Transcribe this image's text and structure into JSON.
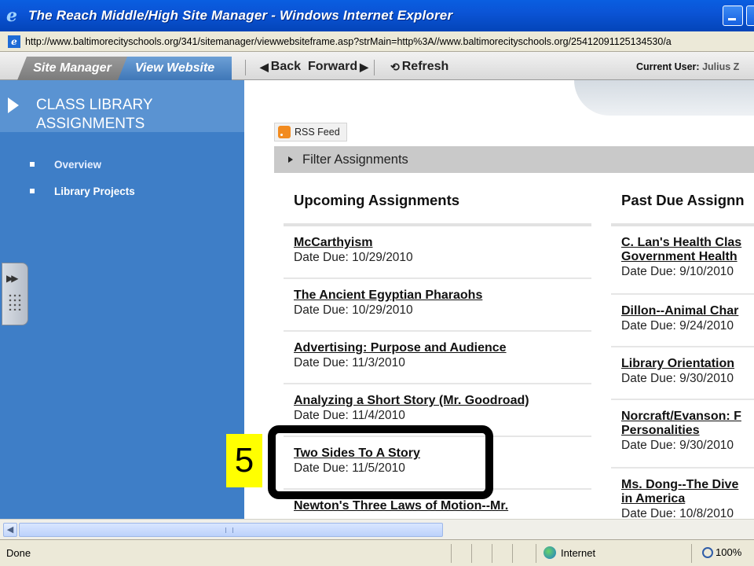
{
  "window": {
    "title": "The Reach Middle/High Site Manager - Windows Internet Explorer",
    "url": "http://www.baltimorecityschools.org/341/sitemanager/viewwebsiteframe.asp?strMain=http%3A//www.baltimorecityschools.org/25412091125134530/a"
  },
  "toolbar": {
    "tab_site_manager": "Site Manager",
    "tab_view_website": "View Website",
    "back": "Back",
    "forward": "Forward",
    "refresh": "Refresh",
    "current_user_label": "Current User:",
    "current_user_name": "Julius Z"
  },
  "sidebar": {
    "title": "CLASS LIBRARY ASSIGNMENTS",
    "items": [
      {
        "label": "Overview"
      },
      {
        "label": "Library Projects"
      }
    ]
  },
  "main": {
    "rss_label": "RSS Feed",
    "filter_label": "Filter Assignments",
    "upcoming_heading": "Upcoming Assignments",
    "past_heading": "Past Due Assignn",
    "upcoming": [
      {
        "name": "McCarthyism",
        "due": "Date Due: 10/29/2010"
      },
      {
        "name": "The Ancient Egyptian Pharaohs",
        "due": "Date Due: 10/29/2010"
      },
      {
        "name": "Advertising: Purpose and Audience",
        "due": "Date Due: 11/3/2010"
      },
      {
        "name": "Analyzing a Short Story (Mr. Goodroad)",
        "due": "Date Due: 11/4/2010"
      },
      {
        "name": "Two Sides To A Story",
        "due": "Date Due: 11/5/2010"
      },
      {
        "name": "Newton's Three Laws of Motion--Mr.",
        "due": ""
      }
    ],
    "past": [
      {
        "name": "C. Lan's Health Clas",
        "name2": "Government Health",
        "due": "Date Due: 9/10/2010"
      },
      {
        "name": "Dillon--Animal Char",
        "name2": "",
        "due": "Date Due: 9/24/2010"
      },
      {
        "name": "Library Orientation",
        "name2": "",
        "due": "Date Due: 9/30/2010"
      },
      {
        "name": "Norcraft/Evanson: F",
        "name2": "Personalities",
        "due": "Date Due: 9/30/2010"
      },
      {
        "name": "Ms. Dong--The Dive",
        "name2": "in America",
        "due": "Date Due: 10/8/2010"
      }
    ]
  },
  "annotation": {
    "step_number": "5"
  },
  "status": {
    "text": "Done",
    "zone": "Internet",
    "zoom": "100%"
  }
}
